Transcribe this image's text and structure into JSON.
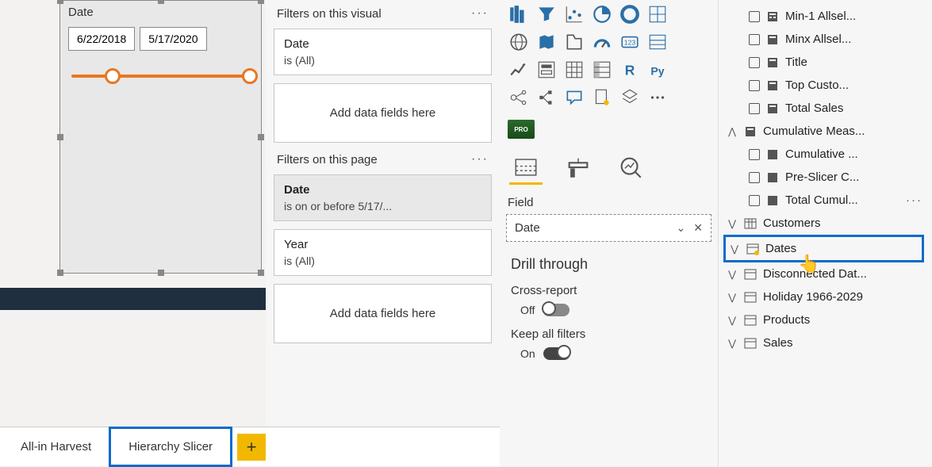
{
  "canvas": {
    "visual_title": "Date",
    "date_start": "6/22/2018",
    "date_end": "5/17/2020"
  },
  "tabs": {
    "tab1": "All-in Harvest",
    "tab2": "Hierarchy Slicer",
    "add": "+"
  },
  "filters": {
    "visual_header": "Filters on this visual",
    "visual_card_name": "Date",
    "visual_card_val": "is (All)",
    "add_fields": "Add data fields here",
    "page_header": "Filters on this page",
    "page_card1_name": "Date",
    "page_card1_val": "is on or before 5/17/...",
    "page_card2_name": "Year",
    "page_card2_val": "is (All)"
  },
  "viz": {
    "field_label": "Field",
    "field_value": "Date",
    "drill_title": "Drill through",
    "cross_label": "Cross-report",
    "cross_state": "Off",
    "keep_label": "Keep all filters",
    "keep_state": "On",
    "pro": "PRO"
  },
  "fields": {
    "m1": "Min-1 Allsel...",
    "m2": "Minx Allsel...",
    "m3": "Title",
    "m4": "Top Custo...",
    "m5": "Total Sales",
    "g1": "Cumulative Meas...",
    "g1a": "Cumulative ...",
    "g1b": "Pre-Slicer C...",
    "g1c": "Total Cumul...",
    "t1": "Customers",
    "t2": "Dates",
    "t3": "Disconnected Dat...",
    "t4": "Holiday 1966-2029",
    "t5": "Products",
    "t6": "Sales"
  }
}
